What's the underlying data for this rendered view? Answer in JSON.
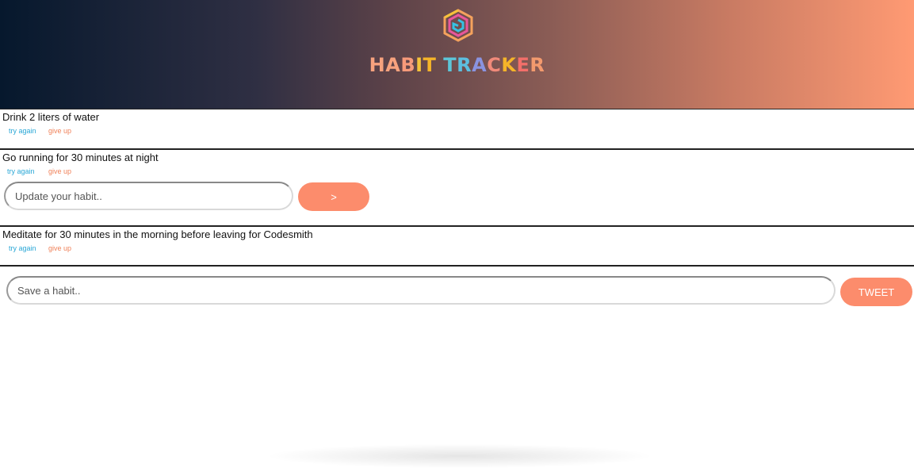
{
  "header": {
    "logo_icon": "hexagon-spiral-logo-icon",
    "title_letters": [
      {
        "char": "H",
        "color": "#f7a27e"
      },
      {
        "char": "A",
        "color": "#f7a27e"
      },
      {
        "char": "B",
        "color": "#f79a7a"
      },
      {
        "char": "I",
        "color": "#f5c23a"
      },
      {
        "char": "T",
        "color": "#f5b429"
      },
      {
        "char": " ",
        "color": "#ffffff"
      },
      {
        "char": "T",
        "color": "#5cc6d9"
      },
      {
        "char": "R",
        "color": "#5cbfe0"
      },
      {
        "char": "A",
        "color": "#8a93e0"
      },
      {
        "char": "C",
        "color": "#f08a7a"
      },
      {
        "char": "K",
        "color": "#f5b429"
      },
      {
        "char": "E",
        "color": "#f36f6a"
      },
      {
        "char": "R",
        "color": "#f39a6e"
      }
    ],
    "gradient_start": "#06182d",
    "gradient_end": "#ff9a73"
  },
  "habits": [
    {
      "text": "Drink 2 liters of water",
      "try_label": "try again",
      "give_label": "give up"
    },
    {
      "text": "Go running for 30 minutes at night",
      "try_label": "try again",
      "give_label": "give up"
    },
    {
      "text": "Meditate for 30 minutes in the morning before leaving for Codesmith",
      "try_label": "try again",
      "give_label": "give up"
    }
  ],
  "update_form": {
    "placeholder": "Update your habit..",
    "submit_label": ">"
  },
  "save_form": {
    "placeholder": "Save a habit..",
    "submit_label": "TWEET"
  },
  "colors": {
    "accent": "#fc8c6c",
    "try_again": "#29a7d6",
    "give_up": "#f0825a"
  }
}
